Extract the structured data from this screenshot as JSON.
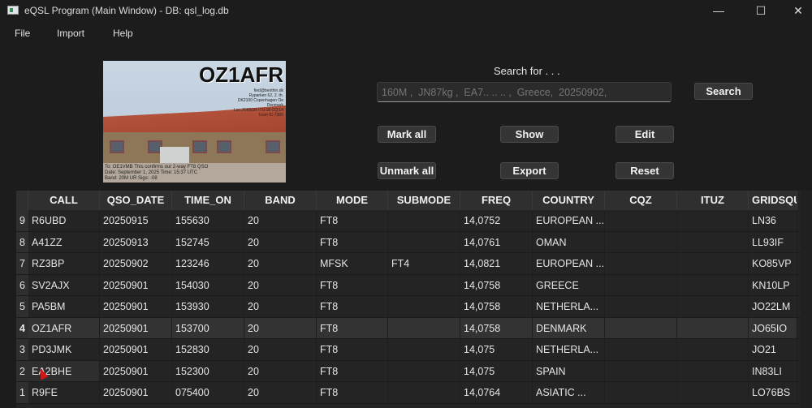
{
  "window": {
    "title": "eQSL Program (Main Window) - DB: qsl_log.db",
    "minimize": "—",
    "maximize": "☐",
    "close": "✕"
  },
  "menu": [
    "File",
    "Import",
    "Help"
  ],
  "card": {
    "call": "OZ1AFR",
    "address": [
      "fied@beothin.dk",
      "Ryparken 62, 2. th.",
      "DK2100 Copenhagen Oe",
      "Denmark",
      "Loc:JO65GR ITU:18 CQ:14",
      "Icom IC-7300"
    ],
    "footer": [
      "To: OE1VMB This confirms our 2-way FT8 QSO",
      "Date: September 1, 2025  Time: 15:37 UTC",
      "Band: 20M UR Sigs: -08"
    ]
  },
  "search": {
    "label": "Search for . . .",
    "placeholder": "160M ,  JN87kg ,  EA7.. .. .. ,  Greece,  20250902,",
    "button": "Search"
  },
  "buttons": {
    "mark_all": "Mark all",
    "show": "Show",
    "edit": "Edit",
    "unmark_all": "Unmark all",
    "export": "Export",
    "reset": "Reset"
  },
  "table": {
    "columns": [
      "CALL",
      "QSO_DATE",
      "TIME_ON",
      "BAND",
      "MODE",
      "SUBMODE",
      "FREQ",
      "COUNTRY",
      "CQZ",
      "ITUZ",
      "GRIDSQUA"
    ],
    "selected_row": "4",
    "rows": [
      {
        "n": "9",
        "cells": [
          "R6UBD",
          "20250915",
          "155630",
          "20",
          "FT8",
          "",
          "14,0752",
          "EUROPEAN ...",
          "",
          "",
          "LN36"
        ]
      },
      {
        "n": "8",
        "cells": [
          "A41ZZ",
          "20250913",
          "152745",
          "20",
          "FT8",
          "",
          "14,0761",
          "OMAN",
          "",
          "",
          "LL93IF"
        ]
      },
      {
        "n": "7",
        "cells": [
          "RZ3BP",
          "20250902",
          "123246",
          "20",
          "MFSK",
          "FT4",
          "14,0821",
          "EUROPEAN ...",
          "",
          "",
          "KO85VP"
        ]
      },
      {
        "n": "6",
        "cells": [
          "SV2AJX",
          "20250901",
          "154030",
          "20",
          "FT8",
          "",
          "14,0758",
          "GREECE",
          "",
          "",
          "KN10LP"
        ]
      },
      {
        "n": "5",
        "cells": [
          "PA5BM",
          "20250901",
          "153930",
          "20",
          "FT8",
          "",
          "14,0758",
          "NETHERLA...",
          "",
          "",
          "JO22LM"
        ]
      },
      {
        "n": "4",
        "cells": [
          "OZ1AFR",
          "20250901",
          "153700",
          "20",
          "FT8",
          "",
          "14,0758",
          "DENMARK",
          "",
          "",
          "JO65IO"
        ]
      },
      {
        "n": "3",
        "cells": [
          "PD3JMK",
          "20250901",
          "152830",
          "20",
          "FT8",
          "",
          "14,075",
          "NETHERLA...",
          "",
          "",
          "JO21"
        ]
      },
      {
        "n": "2",
        "cells": [
          "EA2BHE",
          "20250901",
          "152300",
          "20",
          "FT8",
          "",
          "14,075",
          "SPAIN",
          "",
          "",
          "IN83LI"
        ]
      },
      {
        "n": "1",
        "cells": [
          "R9FE",
          "20250901",
          "075400",
          "20",
          "FT8",
          "",
          "14,0764",
          "ASIATIC ...",
          "",
          "",
          "LO76BS"
        ]
      }
    ]
  }
}
